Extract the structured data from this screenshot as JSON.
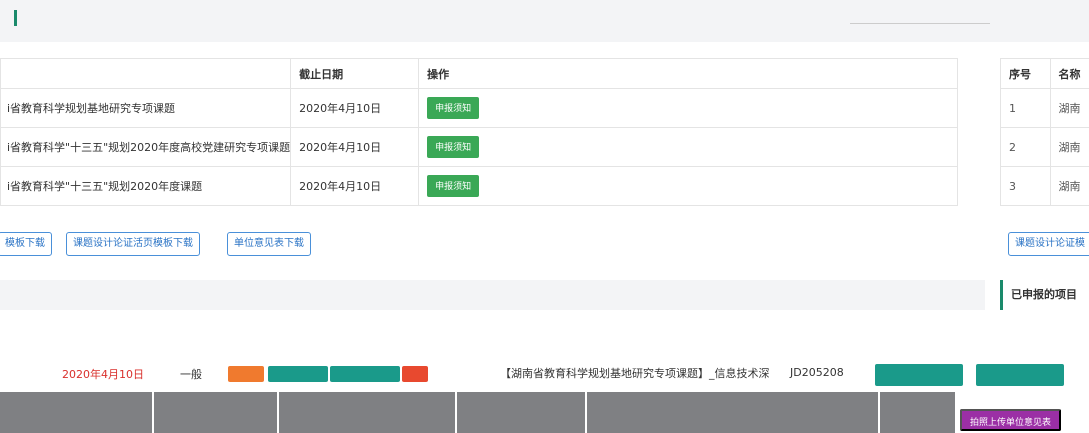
{
  "topbar": {
    "title": "",
    "right": ""
  },
  "tasks": {
    "headers": [
      "",
      "截止日期",
      "操作"
    ],
    "rows": [
      {
        "name": "i省教育科学规划基地研究专项课题",
        "deadline": "2020年4月10日",
        "action": "申报须知"
      },
      {
        "name": "i省教育科学\"十三五\"规划2020年度高校党建研究专项课题",
        "deadline": "2020年4月10日",
        "action": "申报须知"
      },
      {
        "name": "i省教育科学\"十三五\"规划2020年度课题",
        "deadline": "2020年4月10日",
        "action": "申报须知"
      }
    ]
  },
  "side_table": {
    "headers": [
      "序号",
      "名称"
    ],
    "rows": [
      {
        "no": "1",
        "name": "湖南"
      },
      {
        "no": "2",
        "name": "湖南"
      },
      {
        "no": "3",
        "name": "湖南"
      }
    ]
  },
  "downloads": [
    "模板下载",
    "课题设计论证活页模板下载",
    "单位意见表下载",
    "课题设计论证模"
  ],
  "applied_title": "已申报的项目",
  "applied_row": {
    "date": "2020年4月10日",
    "level": "一般",
    "title": "【湖南省教育科学规划基地研究专项课题】_信息技术深",
    "id": "JD205208"
  },
  "upload_button": "拍照上传单位意见表",
  "colors": {
    "accent": "#1a8a6b",
    "green": "#3aa856",
    "purple": "#9b2fa5",
    "link": "#2a73c5",
    "red": "#d9302c"
  }
}
